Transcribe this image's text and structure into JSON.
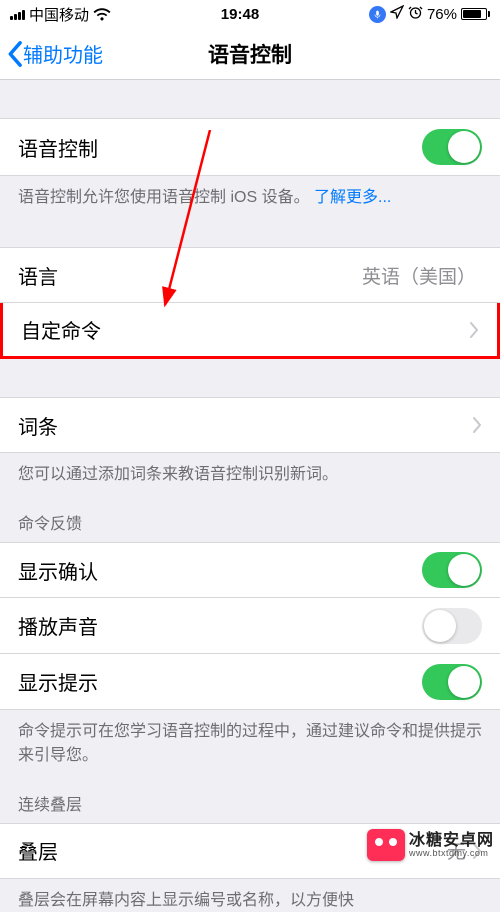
{
  "status": {
    "carrier": "中国移动",
    "time": "19:48",
    "battery_pct": "76%"
  },
  "nav": {
    "back_label": "辅助功能",
    "title": "语音控制"
  },
  "voice_control": {
    "label": "语音控制",
    "enabled": true,
    "footer": "语音控制允许您使用语音控制 iOS 设备。",
    "learn_more": "了解更多..."
  },
  "language": {
    "label": "语言",
    "value": "英语（美国）"
  },
  "custom_commands": {
    "label": "自定命令"
  },
  "vocabulary": {
    "label": "词条",
    "footer": "您可以通过添加词条来教语音控制识别新词。"
  },
  "feedback": {
    "header": "命令反馈",
    "show_confirmation": {
      "label": "显示确认",
      "on": true
    },
    "play_sound": {
      "label": "播放声音",
      "on": false
    },
    "show_hints": {
      "label": "显示提示",
      "on": true
    },
    "footer": "命令提示可在您学习语音控制的过程中，通过建议命令和提供提示来引导您。"
  },
  "overlay": {
    "header": "连续叠层",
    "label": "叠层",
    "value": "无",
    "footer": "叠层会在屏幕内容上显示编号或名称，以方便快"
  },
  "watermark": {
    "cn": "冰糖安卓网",
    "en": "www.btxtdmy.com"
  }
}
